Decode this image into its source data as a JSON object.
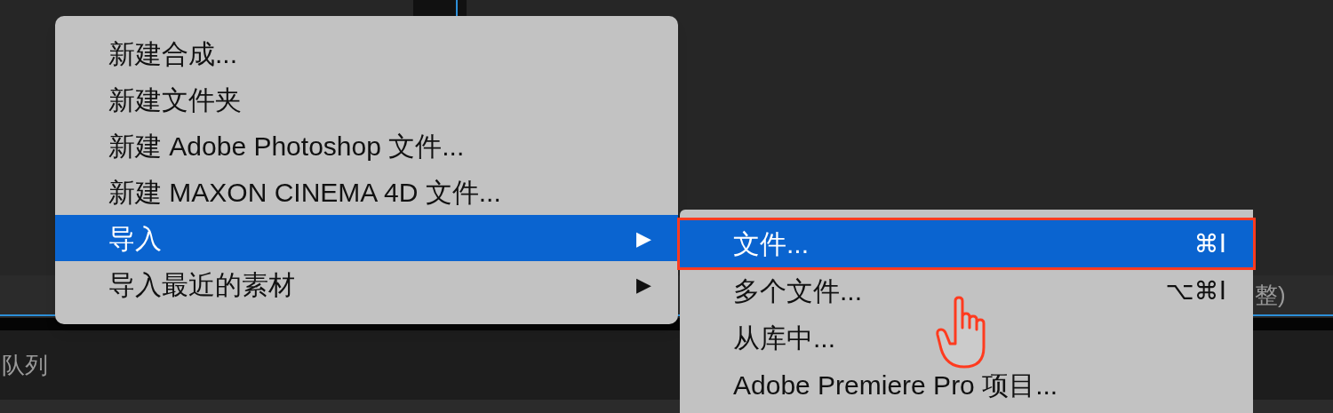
{
  "background": {
    "panel_tab": "队列",
    "status_text": "整)"
  },
  "menu": {
    "items": [
      {
        "label": "新建合成...",
        "selected": false
      },
      {
        "label": "新建文件夹",
        "selected": false
      },
      {
        "label": "新建 Adobe Photoshop 文件...",
        "selected": false
      },
      {
        "label": "新建 MAXON CINEMA 4D 文件...",
        "selected": false
      },
      {
        "label": "导入",
        "selected": true,
        "submenu_arrow": "▶"
      },
      {
        "label": "导入最近的素材",
        "selected": false,
        "submenu_arrow": "▶"
      }
    ]
  },
  "submenu": {
    "items": [
      {
        "label": "文件...",
        "shortcut": "⌘I",
        "selected": true,
        "outlined": true
      },
      {
        "label": "多个文件...",
        "shortcut": "⌥⌘I",
        "selected": false,
        "outlined": false
      },
      {
        "label": "从库中...",
        "selected": false,
        "outlined": false
      },
      {
        "label": "Adobe Premiere Pro 项目...",
        "selected": false,
        "outlined": false
      }
    ]
  }
}
